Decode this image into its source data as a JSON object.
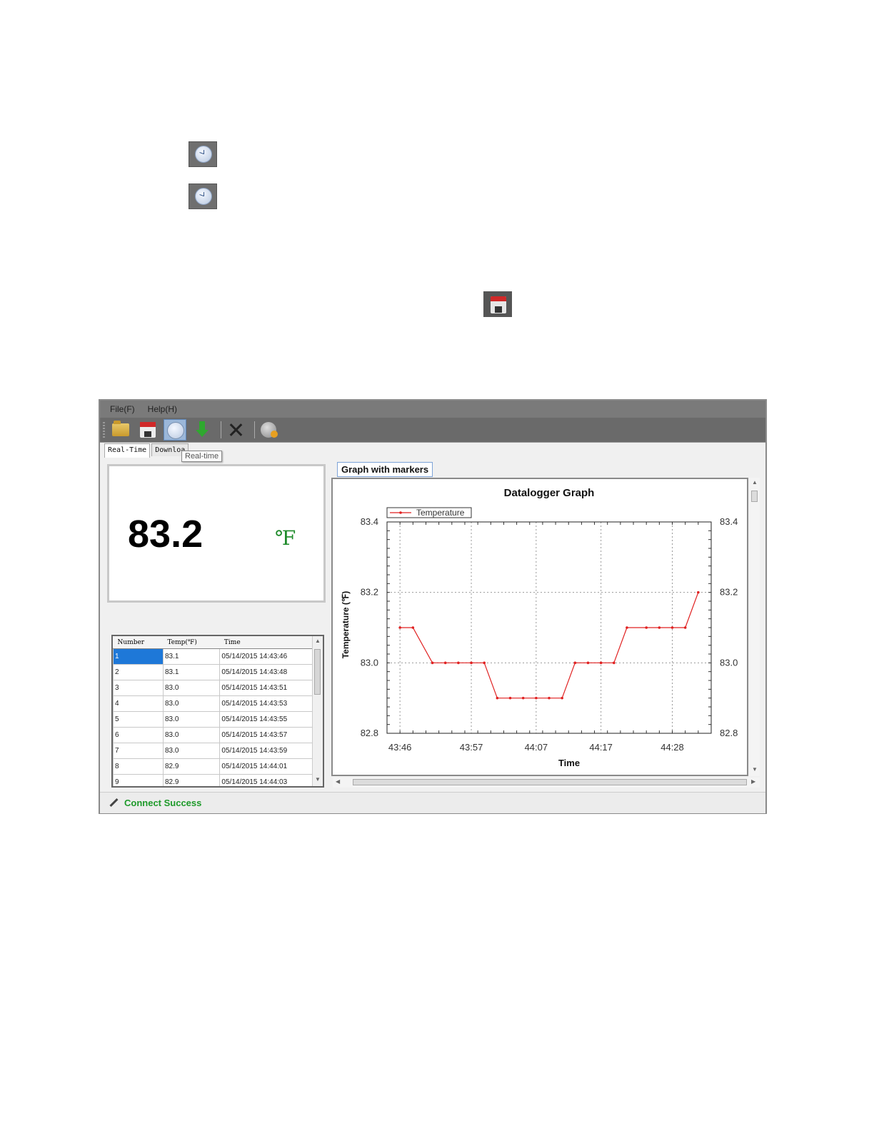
{
  "page_icons": [
    {
      "name": "realtime-clock-icon"
    },
    {
      "name": "realtime-clock-icon"
    },
    {
      "name": "save-floppy-icon"
    }
  ],
  "menu": {
    "file": "File(F)",
    "help": "Help(H)"
  },
  "toolbar": {
    "buttons": [
      "open-folder-icon",
      "save-floppy-icon",
      "realtime-clock-icon",
      "download-arrow-icon",
      "settings-tools-icon",
      "database-icon"
    ],
    "active": "realtime-clock-icon"
  },
  "tabs": {
    "realtime": "Real-Time",
    "download": "Downloa"
  },
  "tooltip": "Real-time",
  "reading": {
    "value": "83.2",
    "unit": "℉"
  },
  "table": {
    "headers": [
      "Number",
      "Temp(℉)",
      "Time"
    ],
    "rows": [
      [
        "1",
        "83.1",
        "05/14/2015 14:43:46"
      ],
      [
        "2",
        "83.1",
        "05/14/2015 14:43:48"
      ],
      [
        "3",
        "83.0",
        "05/14/2015 14:43:51"
      ],
      [
        "4",
        "83.0",
        "05/14/2015 14:43:53"
      ],
      [
        "5",
        "83.0",
        "05/14/2015 14:43:55"
      ],
      [
        "6",
        "83.0",
        "05/14/2015 14:43:57"
      ],
      [
        "7",
        "83.0",
        "05/14/2015 14:43:59"
      ],
      [
        "8",
        "82.9",
        "05/14/2015 14:44:01"
      ],
      [
        "9",
        "82.9",
        "05/14/2015 14:44:03"
      ]
    ]
  },
  "graph_tab": "Graph with markers",
  "chart_data": {
    "type": "line",
    "title": "Datalogger Graph",
    "xlabel": "Time",
    "ylabel": "Temperature (℉)",
    "ylim": [
      82.8,
      83.4
    ],
    "yticks": [
      "82.8",
      "83.0",
      "83.2",
      "83.4"
    ],
    "xticks": [
      "43:46",
      "43:57",
      "44:07",
      "44:17",
      "44:28"
    ],
    "legend": "top-left",
    "grid": true,
    "colors": {
      "series": "#e02020"
    },
    "series": [
      {
        "name": "Temperature",
        "x": [
          "43:46",
          "43:48",
          "43:51",
          "43:53",
          "43:55",
          "43:57",
          "43:59",
          "44:01",
          "44:03",
          "44:05",
          "44:07",
          "44:09",
          "44:11",
          "44:13",
          "44:15",
          "44:17",
          "44:19",
          "44:21",
          "44:24",
          "44:26",
          "44:28",
          "44:30",
          "44:32"
        ],
        "values": [
          83.1,
          83.1,
          83.0,
          83.0,
          83.0,
          83.0,
          83.0,
          82.9,
          82.9,
          82.9,
          82.9,
          82.9,
          82.9,
          83.0,
          83.0,
          83.0,
          83.0,
          83.1,
          83.1,
          83.1,
          83.1,
          83.1,
          83.2
        ]
      }
    ]
  },
  "status": {
    "text": "Connect Success"
  }
}
